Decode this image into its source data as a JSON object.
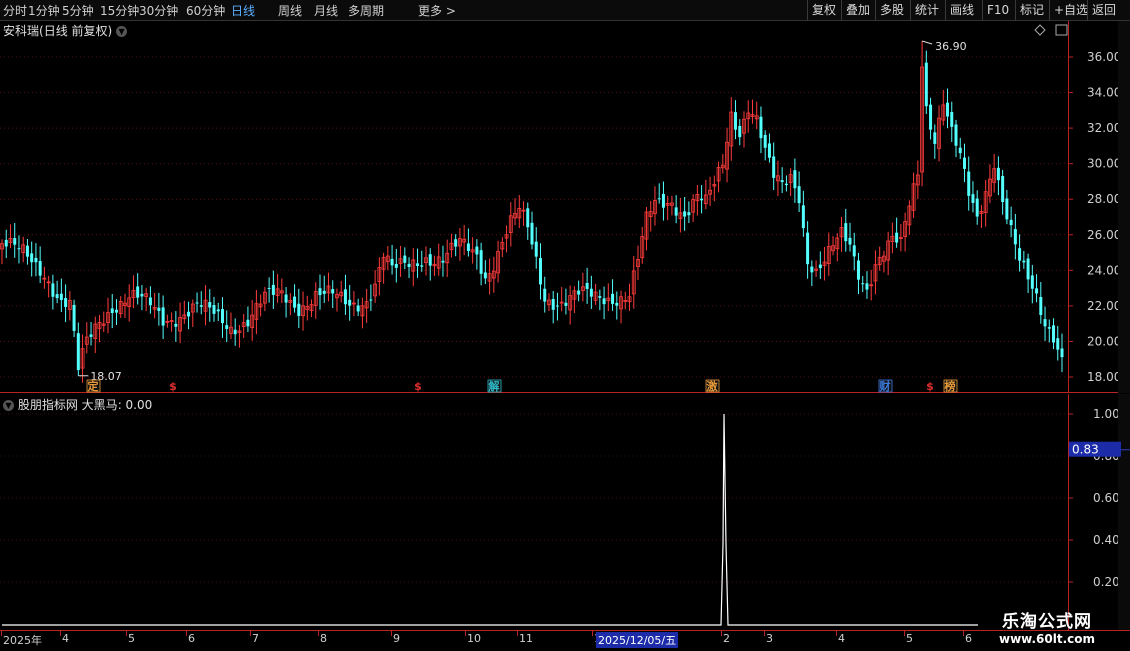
{
  "toolbar": {
    "periods": [
      "分时",
      "1分钟",
      "5分钟",
      "15分钟",
      "30分钟",
      "60分钟",
      "日线",
      "周线",
      "月线",
      "多周期",
      "更多"
    ],
    "active_period": "日线",
    "right_buttons": [
      "复权",
      "叠加",
      "多股",
      "统计",
      "画线",
      "F10",
      "标记",
      "+自选",
      "返回"
    ]
  },
  "main_chart": {
    "stock_name": "安科瑞",
    "mode": "(日线 前复权)",
    "high_label": "36.90",
    "low_label": "18.07",
    "markers": [
      {
        "text": "定",
        "color": "#e89a3a",
        "box": true
      },
      {
        "text": "$",
        "color": "#e03030",
        "box": false
      },
      {
        "text": "$",
        "color": "#e03030",
        "box": false
      },
      {
        "text": "解",
        "color": "#2fb8c8",
        "box": true
      },
      {
        "text": "激",
        "color": "#e89a3a",
        "box": true
      },
      {
        "text": "财",
        "color": "#3c7ae0",
        "box": true
      },
      {
        "text": "$",
        "color": "#e03030",
        "box": false
      },
      {
        "text": "榜",
        "color": "#e89a3a",
        "box": true
      }
    ]
  },
  "indicator": {
    "name": "股朋指标网",
    "line_name": "大黑马",
    "value_text": "0.00",
    "cursor_value": "0.83"
  },
  "chart_data": [
    {
      "type": "candlestick",
      "title": "安科瑞(日线 前复权)",
      "y_ticks": [
        "18.00",
        "20.00",
        "22.00",
        "24.00",
        "26.00",
        "28.00",
        "30.00",
        "32.00",
        "34.00",
        "36.00"
      ],
      "ylim": [
        17.4,
        37.6
      ],
      "grid": true,
      "close_path": [
        [
          0,
          25.5
        ],
        [
          5,
          24.8
        ],
        [
          10,
          24.0
        ],
        [
          14,
          22.3
        ],
        [
          16,
          22.0
        ],
        [
          18,
          18.2
        ],
        [
          20,
          19.8
        ],
        [
          23,
          21.2
        ],
        [
          26,
          22.1
        ],
        [
          30,
          22.5
        ],
        [
          35,
          21.9
        ],
        [
          38,
          21.3
        ],
        [
          42,
          21.6
        ],
        [
          46,
          21.9
        ],
        [
          50,
          21.4
        ],
        [
          54,
          20.9
        ],
        [
          58,
          21.3
        ],
        [
          62,
          22.3
        ],
        [
          66,
          22.6
        ],
        [
          70,
          22.1
        ],
        [
          74,
          22.6
        ],
        [
          78,
          22.4
        ],
        [
          82,
          22.1
        ],
        [
          86,
          22.5
        ],
        [
          88,
          23.3
        ],
        [
          90,
          24.8
        ],
        [
          92,
          23.8
        ],
        [
          96,
          24.3
        ],
        [
          100,
          24.9
        ],
        [
          104,
          24.6
        ],
        [
          108,
          25.3
        ],
        [
          112,
          24.9
        ],
        [
          114,
          23.8
        ],
        [
          116,
          24.6
        ],
        [
          118,
          25.7
        ],
        [
          120,
          26.6
        ],
        [
          122,
          27.2
        ],
        [
          124,
          26.2
        ],
        [
          126,
          24.5
        ],
        [
          128,
          22.6
        ],
        [
          132,
          22.3
        ],
        [
          136,
          22.5
        ],
        [
          140,
          22.4
        ],
        [
          144,
          22.6
        ],
        [
          148,
          22.7
        ],
        [
          150,
          24.5
        ],
        [
          152,
          26.6
        ],
        [
          154,
          27.6
        ],
        [
          158,
          28.0
        ],
        [
          161,
          27.3
        ],
        [
          164,
          28.1
        ],
        [
          166,
          27.6
        ],
        [
          168,
          28.6
        ],
        [
          170,
          29.9
        ],
        [
          172,
          32.9
        ],
        [
          174,
          32.0
        ],
        [
          176,
          33.4
        ],
        [
          178,
          32.5
        ],
        [
          180,
          30.5
        ],
        [
          182,
          29.0
        ],
        [
          184,
          28.6
        ],
        [
          186,
          29.3
        ],
        [
          188,
          28.4
        ],
        [
          189,
          26.6
        ],
        [
          190,
          24.8
        ],
        [
          192,
          24.0
        ],
        [
          194,
          24.4
        ],
        [
          196,
          25.1
        ],
        [
          198,
          25.8
        ],
        [
          200,
          25.4
        ],
        [
          202,
          24.0
        ],
        [
          204,
          23.2
        ],
        [
          206,
          24.5
        ],
        [
          208,
          25.0
        ],
        [
          210,
          25.5
        ],
        [
          212,
          25.2
        ],
        [
          214,
          27.6
        ],
        [
          216,
          29.6
        ],
        [
          217,
          35.9
        ],
        [
          218,
          33.4
        ],
        [
          220,
          31.6
        ],
        [
          222,
          33.6
        ],
        [
          224,
          31.6
        ],
        [
          226,
          30.1
        ],
        [
          228,
          28.1
        ],
        [
          230,
          26.9
        ],
        [
          232,
          28.6
        ],
        [
          234,
          30.4
        ],
        [
          236,
          28.1
        ],
        [
          238,
          26.2
        ],
        [
          240,
          24.3
        ],
        [
          242,
          23.2
        ],
        [
          244,
          22.3
        ],
        [
          246,
          21.1
        ],
        [
          248,
          20.6
        ],
        [
          250,
          19.3
        ]
      ],
      "n_days": 251
    },
    {
      "type": "line",
      "title": "股朋指标网 大黑马",
      "y_ticks": [
        "0.20",
        "0.40",
        "0.60",
        "0.80",
        "1.00"
      ],
      "ylim": [
        0,
        1.03
      ],
      "x_labels": [
        "2025年",
        "4",
        "5",
        "6",
        "7",
        "8",
        "9",
        "10",
        "11",
        "12",
        "2",
        "3",
        "4",
        "5",
        "6"
      ],
      "current_date": "2025/12/05/五",
      "series": [
        {
          "values_nonzero": [
            [
              169,
              0.38
            ],
            [
              170,
              1.0
            ],
            [
              171,
              0.38
            ]
          ]
        }
      ]
    }
  ]
}
